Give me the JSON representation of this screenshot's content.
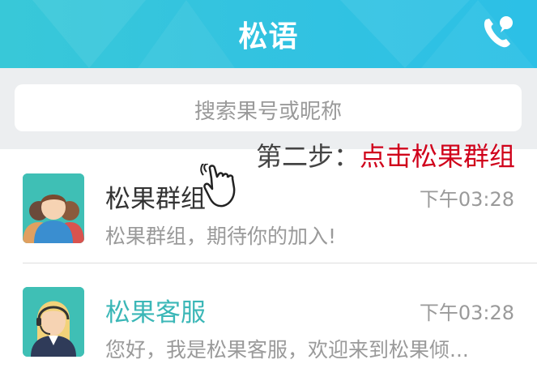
{
  "header": {
    "title": "松语",
    "call_icon": "phone-chat-icon"
  },
  "search": {
    "placeholder": "搜索果号或昵称"
  },
  "instruction": {
    "prefix": "第二步：",
    "highlight": "点击松果群组",
    "highlight_color": "#d0021b"
  },
  "conversations": [
    {
      "name": "松果群组",
      "time": "下午03:28",
      "message": "松果群组，期待你的加入!",
      "avatar": "group-avatar"
    },
    {
      "name": "松果客服",
      "time": "下午03:28",
      "message": "您好，我是松果客服，欢迎来到松果倾...",
      "avatar": "support-agent-avatar"
    }
  ],
  "colors": {
    "header": "#33c3e0",
    "accent_name": "#3bb7b7",
    "search_bg": "#eceef0"
  }
}
